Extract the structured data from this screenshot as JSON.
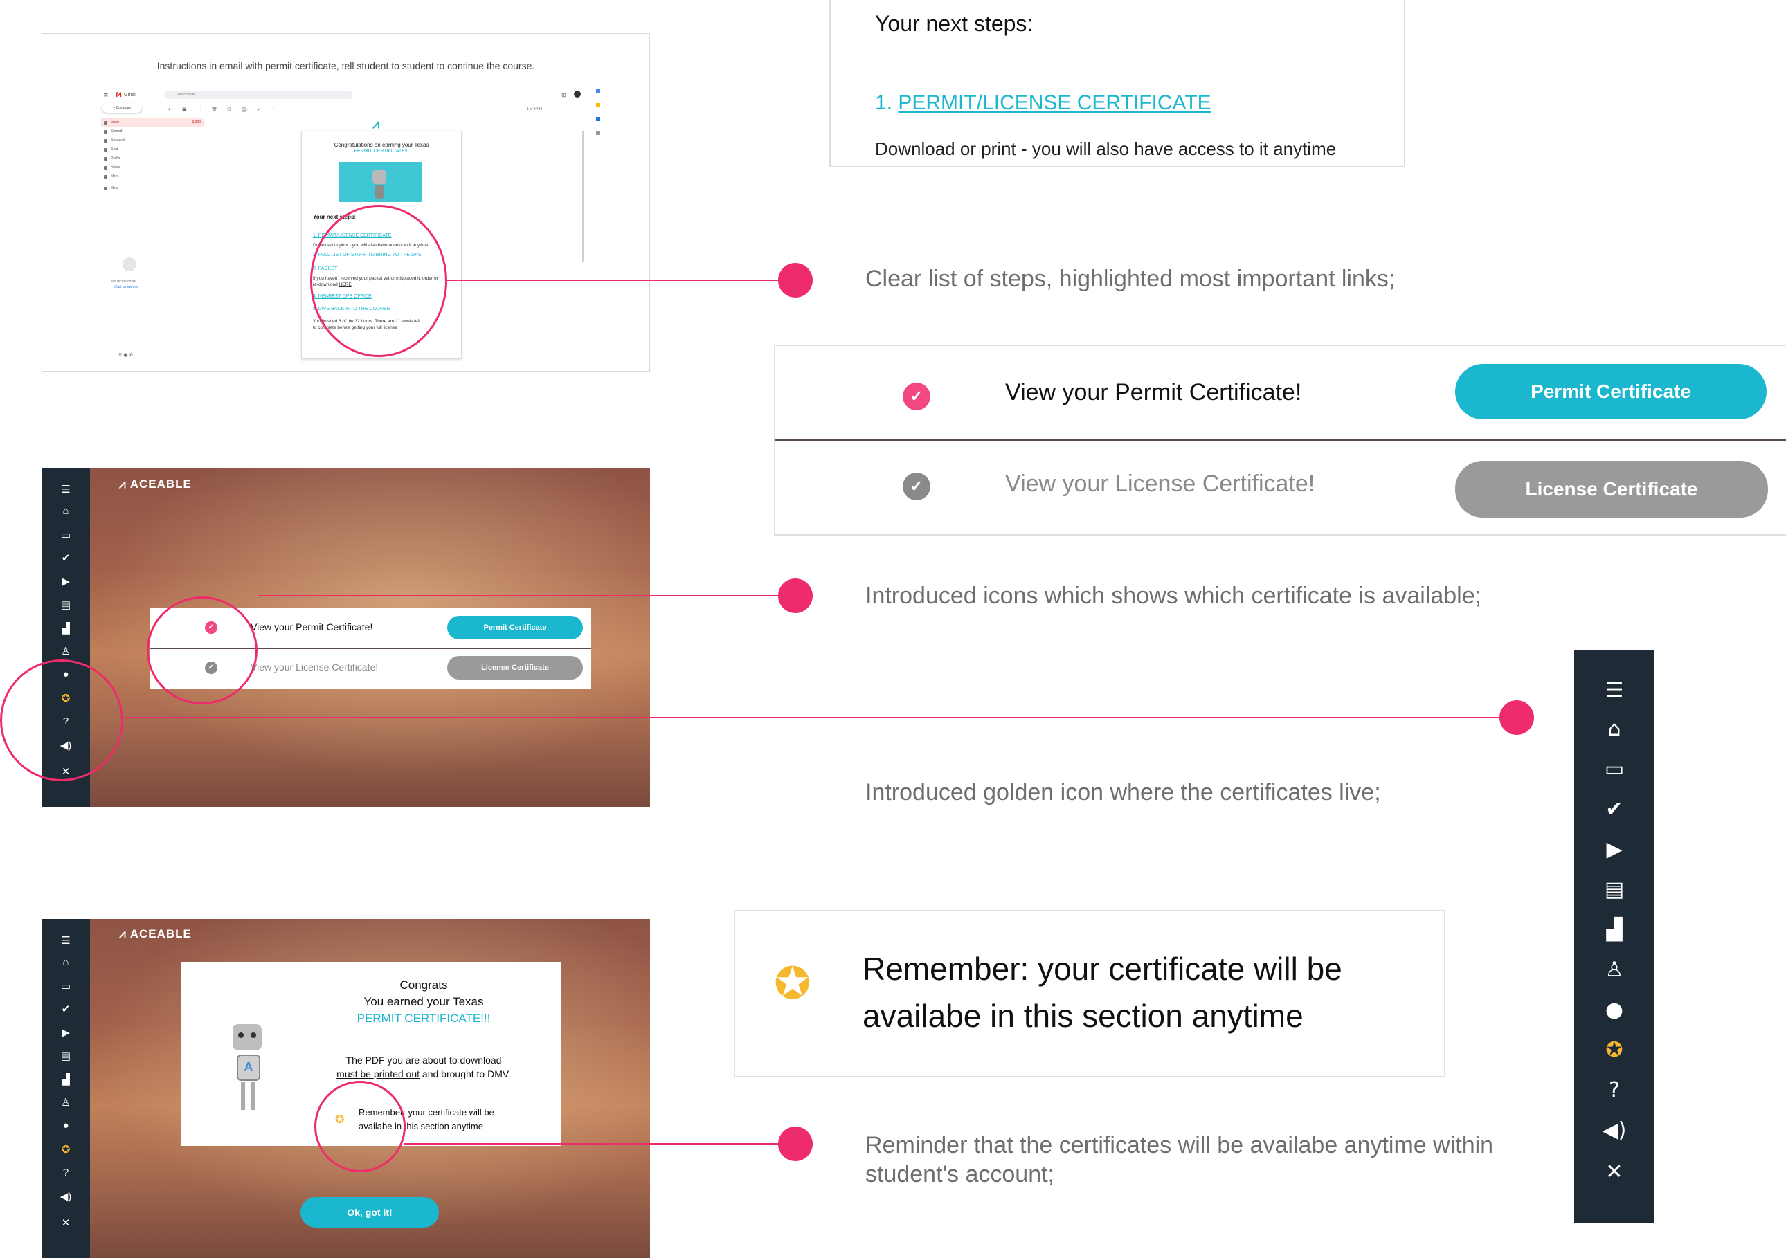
{
  "email_panel": {
    "caption": "Instructions in email with permit certificate, tell student to student to continue the course.",
    "gmail": {
      "brand": "Gmail",
      "search_placeholder": "Search mail",
      "compose": "Compose",
      "pagination": "1 of 3,489",
      "sidebar": [
        "Inbox",
        "Starred",
        "Snoozed",
        "Sent",
        "Drafts",
        "Notes",
        "More"
      ],
      "inbox_count": "3,299",
      "meet_label": "Meta",
      "no_chats": "No recent chats",
      "start_chat": "Start a new one"
    },
    "card": {
      "congrats": "Congratulations on earning your Texas",
      "permit": "PERMIT CERTIFICATE!!!",
      "next_steps": "Your next steps:",
      "step1": "1. PERMIT/LICENSE CERTIFICATE",
      "step1_desc": "Download or print - you will also have access to it anytime",
      "step2": "2. FULL LIST OF STUFF TO BRING TO THE DPS",
      "step3": "3. PACKET",
      "step3_desc": "If you haven't received your packet yet or misplaced it, order or re-download",
      "step3_link": "HERE",
      "step4": "4. NEAREST DPS OFFICE",
      "step5": "5. DIVE BACK INTO THE COURSE",
      "finished_a": "You finished 6 of the 32 hours. There are 11 levels left",
      "finished_b": "to complete before getting your full license"
    }
  },
  "snippet_steps": {
    "heading": "Your next steps:",
    "link_num": "1.",
    "link_text": "PERMIT/LICENSE CERTIFICATE",
    "desc": "Download or print - you will also have access to it anytime"
  },
  "annotations": {
    "a1": "Clear list of steps, highlighted most important links;",
    "a2": "Introduced icons which shows which certificate is available;",
    "a3": "Introduced golden icon where the certificates live;",
    "a4": "Reminder that the certificates will be availabe anytime within student's account;"
  },
  "certs": {
    "permit_label": "View your Permit Certificate!",
    "permit_button": "Permit Certificate",
    "license_label": "View your License Certificate!",
    "license_button": "License Certificate",
    "check_glyph": "✓"
  },
  "app": {
    "logo": "ACEABLE",
    "nav_icons": [
      "menu-icon",
      "home-icon",
      "card-icon",
      "check-circle-icon",
      "play-icon",
      "book-icon",
      "chart-icon",
      "driver-icon",
      "user-icon",
      "certificate-icon",
      "help-icon",
      "volume-icon",
      "close-icon"
    ]
  },
  "modal": {
    "congrats": "Congrats",
    "earned": "You earned your Texas",
    "permit": "PERMIT CERTIFICATE!!!",
    "pdf_a": "The PDF you are about to download",
    "pdf_u": "must be printed out",
    "pdf_b": "and brought to DMV.",
    "remember_a": "Remember: your certificate will be",
    "remember_b": "availabe in this section anytime",
    "ok_button": "Ok, got it!"
  },
  "remember_snippet": {
    "line1": "Remember: your certificate will be",
    "line2": "availabe in this section anytime"
  },
  "colors": {
    "accent": "#1bb7ce",
    "pink": "#ee2b6c",
    "gold": "#f5b82e",
    "nav": "#1e2a36",
    "grey_button": "#9a9a9a"
  }
}
